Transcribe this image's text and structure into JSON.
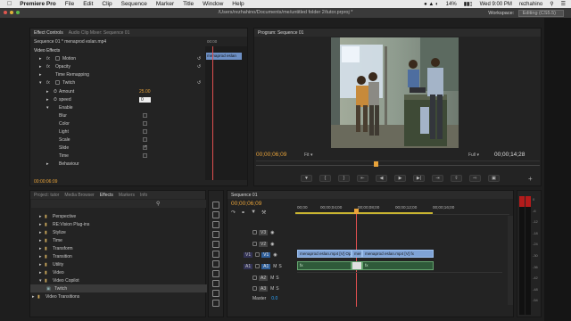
{
  "menubar": {
    "app_name": "Premiere Pro",
    "items": [
      "File",
      "Edit",
      "Clip",
      "Sequence",
      "Marker",
      "Title",
      "Window",
      "Help"
    ],
    "battery": "14%",
    "clock": "Wed 9:00 PM",
    "user": "rezhahino"
  },
  "titlebar": {
    "path": "/Users/rezhahino/Documents/me/untitled folder 2/tutor.prproj *",
    "workspace_label": "Workspace:",
    "workspace_value": "Editing (CS5.5)"
  },
  "effect_controls": {
    "tabs": [
      "Effect Controls",
      "Audio Clip Mixer: Sequence 01"
    ],
    "source_label": "Sequence 01 * menaprod eslan.mp4",
    "mini_time": "00:00",
    "clip_label": "menaprod eslan",
    "section": "Video Effects",
    "rows": [
      "Motion",
      "Opacity",
      "Time Remapping",
      "Twitch"
    ],
    "props": [
      {
        "label": "Amount",
        "value": "25.00"
      },
      {
        "label": "speed",
        "value": "0"
      },
      {
        "label": "Enable",
        "value": ""
      }
    ],
    "enable_items": [
      "Blur",
      "Color",
      "Light",
      "Scale",
      "Slide",
      "Time"
    ],
    "behaviour": "Behaviour",
    "timecode": "00:00:06:09"
  },
  "program": {
    "tab": "Program: Sequence 01",
    "timecode_left": "00;00;06;09",
    "fit": "Fit",
    "quality": "Full",
    "timecode_right": "00;00;14;28"
  },
  "project": {
    "tabs": [
      "Project: tutor",
      "Media Browser",
      "Effects",
      "Markers",
      "Info"
    ],
    "items": [
      {
        "label": "Perspective",
        "indent": 1
      },
      {
        "label": "RE:Vision Plug-ins",
        "indent": 1
      },
      {
        "label": "Stylize",
        "indent": 1
      },
      {
        "label": "Time",
        "indent": 1
      },
      {
        "label": "Transform",
        "indent": 1
      },
      {
        "label": "Transition",
        "indent": 1
      },
      {
        "label": "Utility",
        "indent": 1
      },
      {
        "label": "Video",
        "indent": 1
      },
      {
        "label": "Video Copilot",
        "indent": 1
      },
      {
        "label": "Twitch",
        "indent": 2
      },
      {
        "label": "Video Transitions",
        "indent": 0
      }
    ]
  },
  "timeline": {
    "tab": "Sequence 01",
    "timecode": "00;00;06;09",
    "ruler": [
      "00;00",
      "00;00;04;00",
      "00;00;08;00",
      "00;00;12;00",
      "00;00;16;00"
    ],
    "tracks_video": [
      "V3",
      "V2",
      "V1"
    ],
    "tracks_audio": [
      "A1",
      "A2",
      "A3"
    ],
    "master": "Master",
    "master_value": "0.0",
    "clips_video": [
      {
        "label": "menaprod eslan.mp4 [V] Opa"
      },
      {
        "label": "mer"
      },
      {
        "label": "menaprod eslan.mp4 [V] fx"
      }
    ],
    "clips_audio": [
      {
        "label": "fx"
      },
      {
        "label": "fx"
      }
    ]
  },
  "meter": {
    "scale": [
      "0",
      "-6",
      "-12",
      "-18",
      "-24",
      "-30",
      "-36",
      "-42",
      "-48",
      "-54"
    ]
  },
  "colors": {
    "accent_blue": "#2aa4ff",
    "timecode_orange": "#e8a33a",
    "clip_video": "#7fa3d6",
    "clip_audio": "#2f5a3a",
    "playhead": "#e05050"
  }
}
